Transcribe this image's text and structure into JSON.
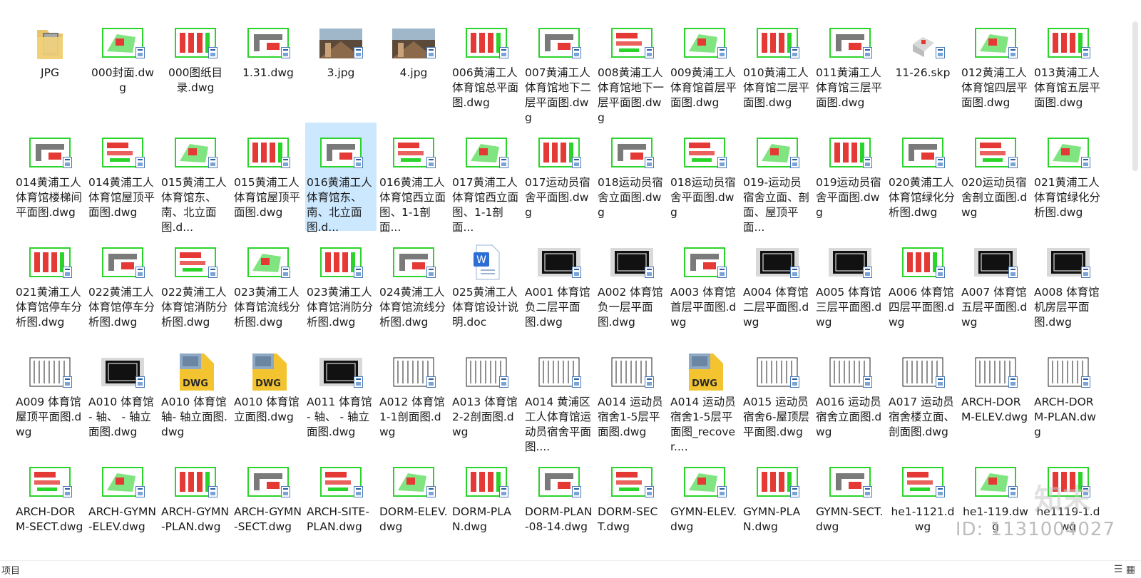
{
  "status": {
    "left_text": "项目"
  },
  "watermark": {
    "id_text": "ID: 1131004027",
    "logo_text": "知末"
  },
  "colors": {
    "selection": "#cce8ff",
    "cad_green": "#2bd42b",
    "cad_red": "#e53935"
  },
  "files": [
    {
      "name": "JPG",
      "icon": "folder-icon"
    },
    {
      "name": "000封面.dwg",
      "icon": "drawing-thumb"
    },
    {
      "name": "000图纸目录.dwg",
      "icon": "drawing-thumb"
    },
    {
      "name": "1.31.dwg",
      "icon": "drawing-thumb"
    },
    {
      "name": "3.jpg",
      "icon": "photo-thumb"
    },
    {
      "name": "4.jpg",
      "icon": "photo-thumb"
    },
    {
      "name": "006黄浦工人体育馆总平面图.dwg",
      "icon": "drawing-thumb"
    },
    {
      "name": "007黄浦工人体育馆地下二层平面图.dwg",
      "icon": "drawing-thumb"
    },
    {
      "name": "008黄浦工人体育馆地下一层平面图.dwg",
      "icon": "drawing-thumb"
    },
    {
      "name": "009黄浦工人体育馆首层平面图.dwg",
      "icon": "drawing-thumb"
    },
    {
      "name": "010黄浦工人体育馆二层平面图.dwg",
      "icon": "drawing-thumb"
    },
    {
      "name": "011黄浦工人体育馆三层平面图.dwg",
      "icon": "drawing-thumb"
    },
    {
      "name": "11-26.skp",
      "icon": "model-thumb"
    },
    {
      "name": "012黄浦工人体育馆四层平面图.dwg",
      "icon": "drawing-thumb"
    },
    {
      "name": "013黄浦工人体育馆五层平面图.dwg",
      "icon": "drawing-thumb"
    },
    {
      "name": "014黄浦工人体育馆楼梯间平面图.dwg",
      "icon": "drawing-thumb"
    },
    {
      "name": "014黄浦工人体育馆屋顶平面图.dwg",
      "icon": "drawing-thumb"
    },
    {
      "name": "015黄浦工人体育馆东、南、北立面图.d...",
      "icon": "drawing-thumb"
    },
    {
      "name": "015黄浦工人体育馆屋顶平面图.dwg",
      "icon": "drawing-thumb"
    },
    {
      "name": "016黄浦工人体育馆东、南、北立面图.d...",
      "icon": "drawing-thumb",
      "selected": true
    },
    {
      "name": "016黄浦工人体育馆西立面图、1-1剖面...",
      "icon": "drawing-thumb"
    },
    {
      "name": "017黄浦工人体育馆西立面图、1-1剖面...",
      "icon": "drawing-thumb"
    },
    {
      "name": "017运动员宿舍平面图.dwg",
      "icon": "drawing-thumb"
    },
    {
      "name": "018运动员宿舍立面图.dwg",
      "icon": "drawing-thumb"
    },
    {
      "name": "018运动员宿舍平面图.dwg",
      "icon": "drawing-thumb"
    },
    {
      "name": "019-运动员宿舍立面、剖面、屋顶平面...",
      "icon": "drawing-thumb"
    },
    {
      "name": "019运动员宿舍平面图.dwg",
      "icon": "drawing-thumb"
    },
    {
      "name": "020黄浦工人体育馆绿化分析图.dwg",
      "icon": "drawing-thumb"
    },
    {
      "name": "020运动员宿舍剖立面图.dwg",
      "icon": "drawing-thumb"
    },
    {
      "name": "021黄浦工人体育馆绿化分析图.dwg",
      "icon": "drawing-thumb"
    },
    {
      "name": "021黄浦工人体育馆停车分析图.dwg",
      "icon": "drawing-thumb"
    },
    {
      "name": "022黄浦工人体育馆停车分析图.dwg",
      "icon": "drawing-thumb"
    },
    {
      "name": "022黄浦工人体育馆消防分析图.dwg",
      "icon": "drawing-thumb"
    },
    {
      "name": "023黄浦工人体育馆流线分析图.dwg",
      "icon": "drawing-thumb"
    },
    {
      "name": "023黄浦工人体育馆消防分析图.dwg",
      "icon": "drawing-thumb"
    },
    {
      "name": "024黄浦工人体育馆流线分析图.dwg",
      "icon": "drawing-thumb"
    },
    {
      "name": "025黄浦工人体育馆设计说明.doc",
      "icon": "word-icon"
    },
    {
      "name": "A001 体育馆负二层平面图.dwg",
      "icon": "drawing-thumb"
    },
    {
      "name": "A002 体育馆负一层平面图.dwg",
      "icon": "drawing-thumb"
    },
    {
      "name": "A003 体育馆首层平面图.dwg",
      "icon": "drawing-thumb"
    },
    {
      "name": "A004 体育馆二层平面图.dwg",
      "icon": "drawing-thumb"
    },
    {
      "name": "A005 体育馆三层平面图.dwg",
      "icon": "drawing-thumb"
    },
    {
      "name": "A006 体育馆四层平面图.dwg",
      "icon": "drawing-thumb"
    },
    {
      "name": "A007 体育馆五层平面图.dwg",
      "icon": "drawing-thumb"
    },
    {
      "name": "A008 体育馆机房层平面图.dwg",
      "icon": "drawing-thumb"
    },
    {
      "name": "A009 体育馆屋顶平面图.dwg",
      "icon": "drawing-thumb"
    },
    {
      "name": "A010 体育馆 - 轴、 - 轴立面图.dwg",
      "icon": "drawing-thumb"
    },
    {
      "name": "A010 体育馆 轴- 轴立面图.dwg",
      "icon": "dwg-icon"
    },
    {
      "name": "A010 体育馆立面图.dwg",
      "icon": "dwg-icon"
    },
    {
      "name": "A011 体育馆 - 轴、 - 轴立面图.dwg",
      "icon": "drawing-thumb"
    },
    {
      "name": "A012 体育馆1-1剖面图.dwg",
      "icon": "drawing-thumb"
    },
    {
      "name": "A013 体育馆2-2剖面图.dwg",
      "icon": "drawing-thumb"
    },
    {
      "name": "A014 黄浦区工人体育馆运动员宿舍平面图....",
      "icon": "drawing-thumb"
    },
    {
      "name": "A014 运动员宿舍1-5层平面图.dwg",
      "icon": "drawing-thumb"
    },
    {
      "name": "A014 运动员宿舍1-5层平面图_recover....",
      "icon": "dwg-icon"
    },
    {
      "name": "A015 运动员宿舍6-屋顶层平面图.dwg",
      "icon": "drawing-thumb"
    },
    {
      "name": "A016 运动员宿舍立面图.dwg",
      "icon": "drawing-thumb"
    },
    {
      "name": "A017 运动员宿舍楼立面、剖面图.dwg",
      "icon": "drawing-thumb"
    },
    {
      "name": "ARCH-DORM-ELEV.dwg",
      "icon": "drawing-thumb"
    },
    {
      "name": "ARCH-DORM-PLAN.dwg",
      "icon": "drawing-thumb"
    },
    {
      "name": "ARCH-DORM-SECT.dwg",
      "icon": "drawing-thumb"
    },
    {
      "name": "ARCH-GYMN-ELEV.dwg",
      "icon": "drawing-thumb"
    },
    {
      "name": "ARCH-GYMN-PLAN.dwg",
      "icon": "drawing-thumb"
    },
    {
      "name": "ARCH-GYMN-SECT.dwg",
      "icon": "drawing-thumb"
    },
    {
      "name": "ARCH-SITE-PLAN.dwg",
      "icon": "drawing-thumb"
    },
    {
      "name": "DORM-ELEV.dwg",
      "icon": "drawing-thumb"
    },
    {
      "name": "DORM-PLAN.dwg",
      "icon": "drawing-thumb"
    },
    {
      "name": "DORM-PLAN-08-14.dwg",
      "icon": "drawing-thumb"
    },
    {
      "name": "DORM-SECT.dwg",
      "icon": "drawing-thumb"
    },
    {
      "name": "GYMN-ELEV.dwg",
      "icon": "drawing-thumb"
    },
    {
      "name": "GYMN-PLAN.dwg",
      "icon": "drawing-thumb"
    },
    {
      "name": "GYMN-SECT.dwg",
      "icon": "drawing-thumb"
    },
    {
      "name": "he1-1121.dwg",
      "icon": "drawing-thumb"
    },
    {
      "name": "he1-119.dwg",
      "icon": "drawing-thumb"
    },
    {
      "name": "he1119-1.dwg",
      "icon": "drawing-thumb"
    }
  ]
}
